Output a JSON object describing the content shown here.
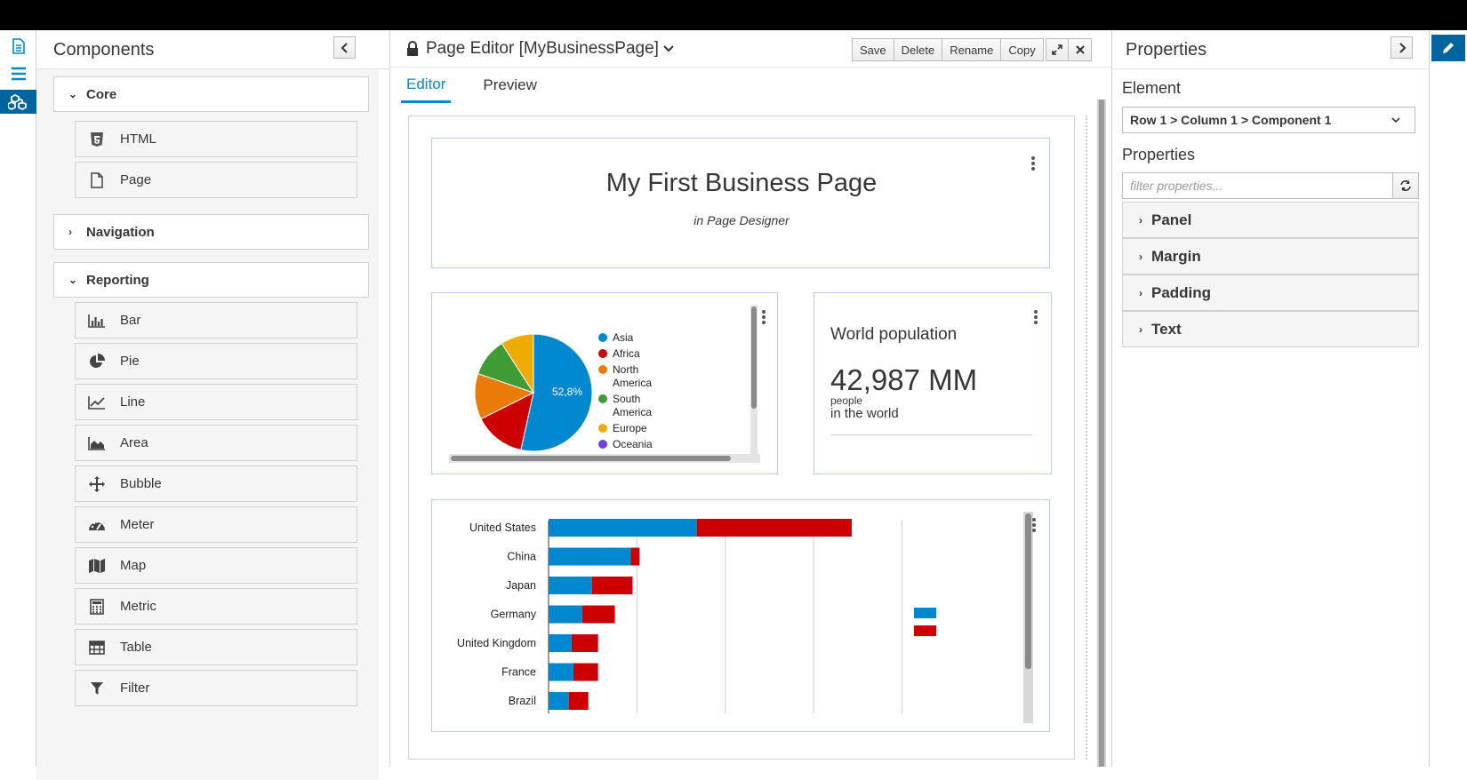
{
  "left_rail": {
    "icons": [
      "document-icon",
      "list-icon",
      "cubes-icon"
    ]
  },
  "components": {
    "title": "Components",
    "groups": {
      "core": {
        "label": "Core",
        "items": [
          {
            "label": "HTML",
            "icon": "html5-icon"
          },
          {
            "label": "Page",
            "icon": "file-icon"
          }
        ]
      },
      "navigation": {
        "label": "Navigation"
      },
      "reporting": {
        "label": "Reporting",
        "items": [
          {
            "label": "Bar",
            "icon": "bar-chart-icon"
          },
          {
            "label": "Pie",
            "icon": "pie-chart-icon"
          },
          {
            "label": "Line",
            "icon": "line-chart-icon"
          },
          {
            "label": "Area",
            "icon": "area-chart-icon"
          },
          {
            "label": "Bubble",
            "icon": "arrows-icon"
          },
          {
            "label": "Meter",
            "icon": "tachometer-icon"
          },
          {
            "label": "Map",
            "icon": "map-icon"
          },
          {
            "label": "Metric",
            "icon": "calculator-icon"
          },
          {
            "label": "Table",
            "icon": "table-icon"
          },
          {
            "label": "Filter",
            "icon": "filter-icon"
          }
        ]
      }
    }
  },
  "editor": {
    "title": "Page Editor [MyBusinessPage]",
    "toolbar": {
      "save": "Save",
      "delete": "Delete",
      "rename": "Rename",
      "copy": "Copy"
    },
    "tabs": {
      "editor": "Editor",
      "preview": "Preview"
    },
    "header_card": {
      "title": "My First Business Page",
      "subtitle": "in Page Designer"
    },
    "metric_card": {
      "title": "World population",
      "value": "42,987 MM",
      "unit": "people",
      "caption": "in the world"
    }
  },
  "properties": {
    "title": "Properties",
    "element_label": "Element",
    "element_value": "Row 1 > Column 1 > Component 1",
    "properties_label": "Properties",
    "filter_placeholder": "filter properties...",
    "sections": [
      "Panel",
      "Margin",
      "Padding",
      "Text"
    ]
  },
  "chart_data": [
    {
      "type": "pie",
      "categories": [
        "Asia",
        "Africa",
        "North America",
        "South America",
        "Europe",
        "Oceania"
      ],
      "values": [
        52.8,
        14.0,
        12.5,
        10.5,
        9.0,
        0.0
      ],
      "data_labels": [
        "52,8%"
      ],
      "colors": [
        "#0088ce",
        "#cc0000",
        "#ec7a08",
        "#3f9c35",
        "#f0ab00",
        "#703fec"
      ],
      "legend": "right"
    },
    {
      "type": "bar",
      "orientation": "horizontal",
      "stacked": true,
      "categories": [
        "United States",
        "China",
        "Japan",
        "Germany",
        "United Kingdom",
        "France",
        "Brazil"
      ],
      "series": [
        {
          "values": [
            168,
            93,
            49,
            38,
            26,
            28,
            23
          ],
          "color": "#0088ce"
        },
        {
          "values": [
            175,
            10,
            46,
            37,
            30,
            28,
            22
          ],
          "color": "#cc0000"
        }
      ],
      "xlim": [
        0,
        500
      ],
      "grid": true,
      "legend": "right"
    }
  ]
}
